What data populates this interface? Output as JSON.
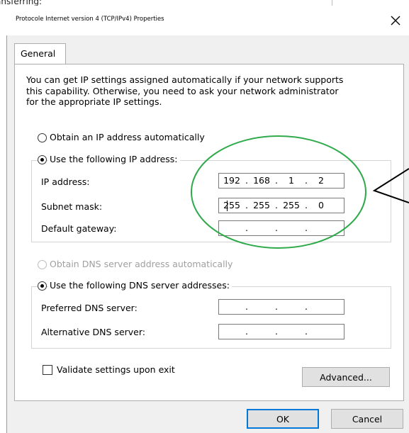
{
  "background_text": "ansferring:",
  "window": {
    "title": "Protocole Internet version 4 (TCP/IPv4) Properties",
    "close_label": "✕"
  },
  "tabs": [
    {
      "label": "General"
    }
  ],
  "intro_lines": [
    "You can get IP settings assigned automatically if your network supports",
    "this capability. Otherwise, you need to ask your network administrator",
    "for the appropriate IP settings."
  ],
  "ip_section": {
    "auto_label": "Obtain an IP address automatically",
    "manual_label": "Use the following IP address:",
    "fields": [
      {
        "label": "IP address:",
        "octets": [
          "192",
          "168",
          "1",
          "2"
        ]
      },
      {
        "label": "Subnet mask:",
        "octets": [
          "255",
          "255",
          "255",
          "0"
        ]
      },
      {
        "label": "Default gateway:",
        "octets": [
          "",
          "",
          "",
          ""
        ]
      }
    ]
  },
  "dns_section": {
    "auto_label": "Obtain DNS server address automatically",
    "manual_label": "Use the following DNS server addresses:",
    "fields": [
      {
        "label": "Preferred DNS server:",
        "octets": [
          "",
          "",
          "",
          ""
        ]
      },
      {
        "label": "Alternative DNS server:",
        "octets": [
          "",
          "",
          "",
          ""
        ]
      }
    ]
  },
  "validate_label": "Validate settings upon exit",
  "buttons": {
    "advanced": "Advanced...",
    "ok": "OK",
    "cancel": "Cancel"
  },
  "colors": {
    "annotation_circle": "#2eaa4a",
    "annotation_arrow": "#000000",
    "default_button_border": "#0078d7"
  }
}
